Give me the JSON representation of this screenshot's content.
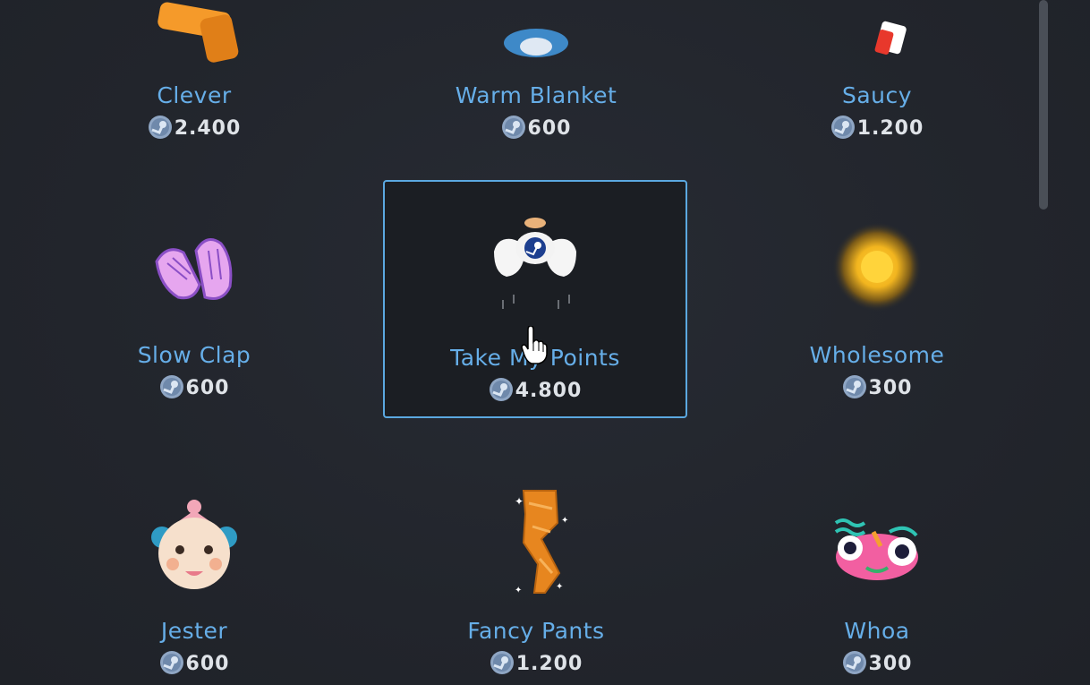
{
  "items": [
    {
      "name": "Clever",
      "price": "2.400",
      "icon": "clever-hand-icon"
    },
    {
      "name": "Warm Blanket",
      "price": "600",
      "icon": "warm-blanket-icon"
    },
    {
      "name": "Saucy",
      "price": "1.200",
      "icon": "saucy-icon"
    },
    {
      "name": "Slow Clap",
      "price": "600",
      "icon": "slow-clap-icon"
    },
    {
      "name": "Take My Points",
      "price": "4.800",
      "icon": "take-my-points-icon",
      "selected": true
    },
    {
      "name": "Wholesome",
      "price": "300",
      "icon": "wholesome-glow-icon"
    },
    {
      "name": "Jester",
      "price": "600",
      "icon": "jester-face-icon"
    },
    {
      "name": "Fancy Pants",
      "price": "1.200",
      "icon": "fancy-pants-icon"
    },
    {
      "name": "Whoa",
      "price": "300",
      "icon": "whoa-face-icon"
    }
  ],
  "colors": {
    "accent": "#66aee8",
    "selection_border": "#5ba8e0",
    "background": "#23262d",
    "price_text": "#dfe3e8"
  },
  "currency_icon": "steam-points-coin-icon"
}
